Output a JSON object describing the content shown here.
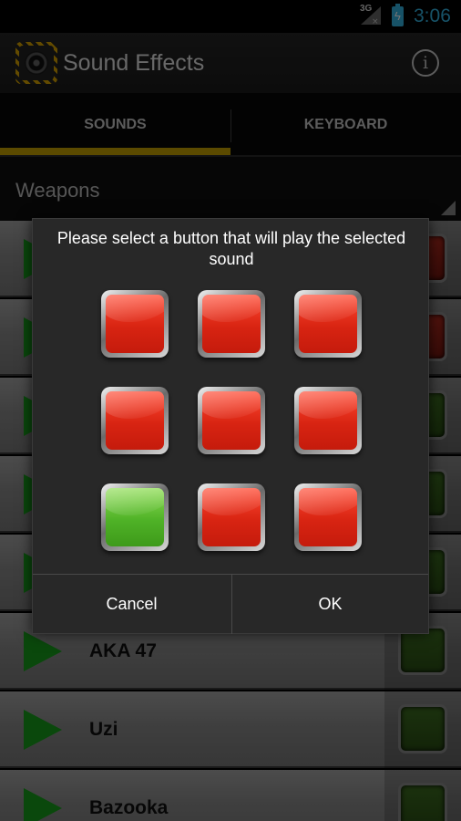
{
  "status_bar": {
    "network": "3G",
    "time": "3:06"
  },
  "action_bar": {
    "title": "Sound Effects"
  },
  "tabs": [
    {
      "label": "SOUNDS",
      "selected": true
    },
    {
      "label": "KEYBOARD",
      "selected": false
    }
  ],
  "category": {
    "selected": "Weapons"
  },
  "list": {
    "items": [
      {
        "label": "",
        "key_color": "red"
      },
      {
        "label": "",
        "key_color": "red"
      },
      {
        "label": "",
        "key_color": "green"
      },
      {
        "label": "",
        "key_color": "green"
      },
      {
        "label": "",
        "key_color": "green"
      },
      {
        "label": "AKA 47",
        "key_color": "green"
      },
      {
        "label": "Uzi",
        "key_color": "green"
      },
      {
        "label": "Bazooka",
        "key_color": "green"
      }
    ]
  },
  "dialog": {
    "message": "Please select a button that will play the selected sound",
    "grid": [
      [
        "red",
        "red",
        "red"
      ],
      [
        "red",
        "red",
        "red"
      ],
      [
        "green",
        "red",
        "red"
      ]
    ],
    "cancel_label": "Cancel",
    "ok_label": "OK"
  },
  "colors": {
    "accent": "#c9a400",
    "clock": "#33b5e5",
    "key_red": "#d82412",
    "key_green": "#4fb227",
    "play_green": "#17a11c"
  }
}
